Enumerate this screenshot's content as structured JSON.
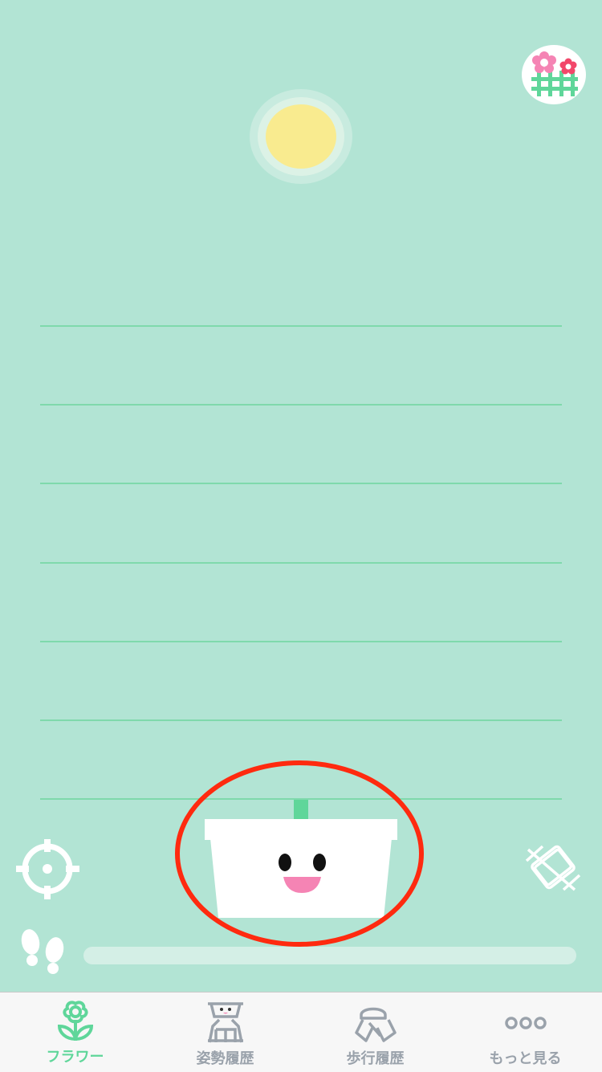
{
  "colors": {
    "background": "#b2e4d4",
    "accent": "#5fd69a",
    "sun": "#f9eb8f",
    "highlight_circle": "#ff2a0f",
    "tab_inactive": "#9aa2ab",
    "flower_pink": "#f584b4",
    "flower_red": "#f2476a"
  },
  "header": {
    "garden_button_icon": "flower-garden-icon"
  },
  "scene": {
    "sun_icon": "sun",
    "pot_face": "smiling-pot",
    "left_button_icon": "crosshair-icon",
    "right_button_icon": "rotate-lock-icon",
    "steps_icon": "footprints-icon",
    "step_progress": 0
  },
  "tabs": [
    {
      "label": "フラワー",
      "icon": "flower-icon",
      "active": true
    },
    {
      "label": "姿勢履歴",
      "icon": "posture-history-icon",
      "active": false
    },
    {
      "label": "歩行履歴",
      "icon": "walking-history-icon",
      "active": false
    },
    {
      "label": "もっと見る",
      "icon": "more-icon",
      "active": false
    }
  ]
}
